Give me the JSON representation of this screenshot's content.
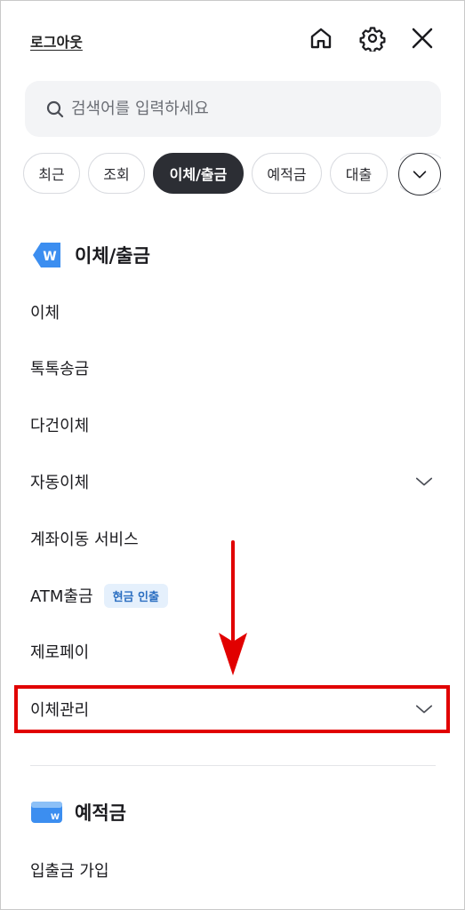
{
  "header": {
    "logout_label": "로그아웃"
  },
  "search": {
    "placeholder": "검색어를 입력하세요"
  },
  "chips": [
    "최근",
    "조회",
    "이체/출금",
    "예적금",
    "대출"
  ],
  "sections": {
    "transfer": {
      "title": "이체/출금",
      "items": [
        "이체",
        "톡톡송금",
        "다건이체",
        "자동이체",
        "계좌이동 서비스",
        "ATM출금",
        "제로페이",
        "이체관리"
      ],
      "atm_badge": "현금 인출"
    },
    "deposit": {
      "title": "예적금",
      "items": [
        "입출금 가입"
      ]
    }
  },
  "colors": {
    "highlight": "#e10000",
    "accent": "#3c8ef0",
    "active_chip": "#2c2e34"
  }
}
